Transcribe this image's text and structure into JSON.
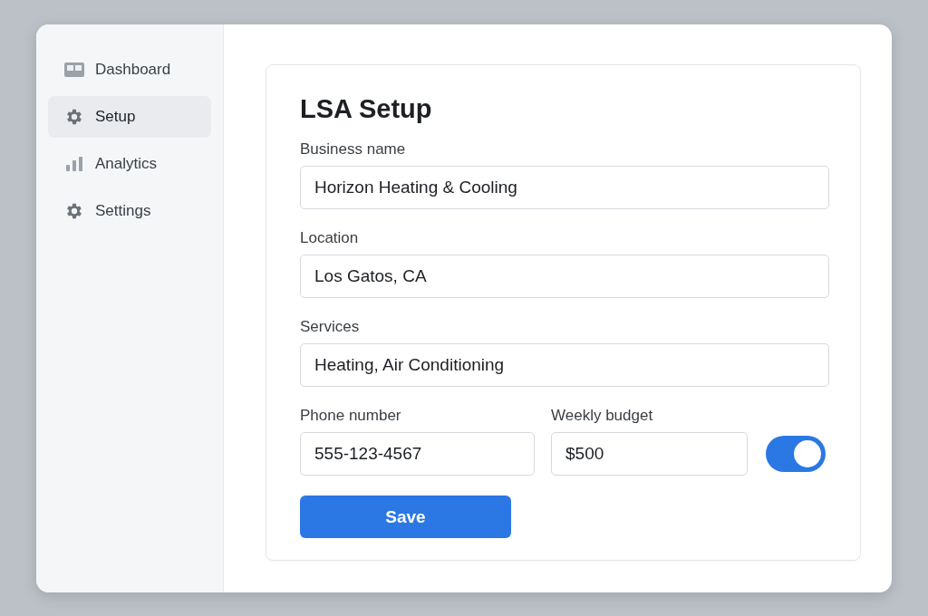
{
  "sidebar": {
    "items": [
      {
        "label": "Dashboard",
        "selected": false
      },
      {
        "label": "Setup",
        "selected": true
      },
      {
        "label": "Analytics",
        "selected": false
      },
      {
        "label": "Settings",
        "selected": false
      }
    ]
  },
  "form": {
    "title": "LSA Setup",
    "fields": [
      {
        "label": "Business name",
        "value": "Horizon Heating & Cooling"
      },
      {
        "label": "Location",
        "value": "Los Gatos, CA"
      },
      {
        "label": "Services",
        "value": "Heating, Air Conditioning"
      }
    ],
    "phone": {
      "label": "Phone number",
      "value": "555-123-4567"
    },
    "budget": {
      "label": "Weekly budget",
      "value": "$500"
    },
    "toggle": {
      "on": true
    },
    "save_button": "Save"
  }
}
